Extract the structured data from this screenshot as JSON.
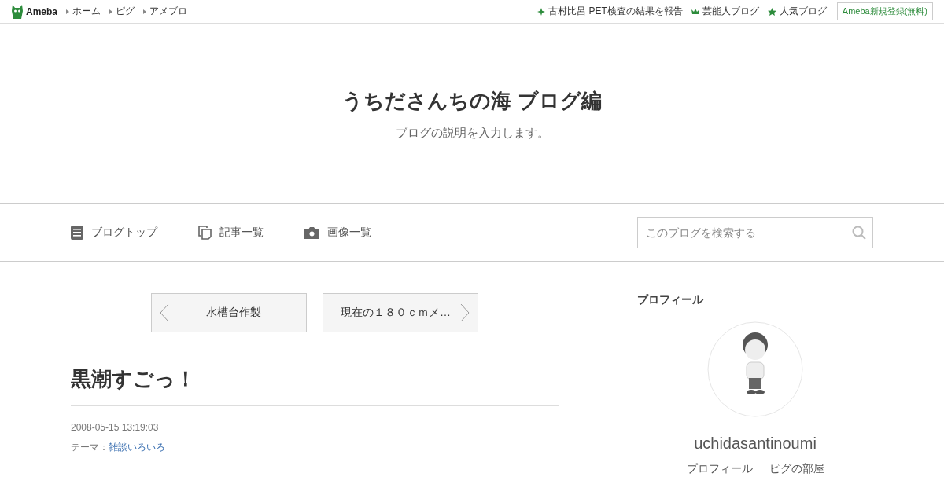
{
  "topbar": {
    "logo": "Ameba",
    "links": [
      "ホーム",
      "ピグ",
      "アメブロ"
    ],
    "right_links": [
      {
        "kind": "sparkle",
        "label": "古村比呂 PET検査の結果を報告"
      },
      {
        "kind": "crown",
        "label": "芸能人ブログ"
      },
      {
        "kind": "star",
        "label": "人気ブログ"
      }
    ],
    "signup": "Ameba新規登録(無料)"
  },
  "blog": {
    "title": "うちださんちの海 ブログ編",
    "description": "ブログの説明を入力します。"
  },
  "nav": {
    "items": [
      {
        "kind": "document",
        "label": "ブログトップ"
      },
      {
        "kind": "copy",
        "label": "記事一覧"
      },
      {
        "kind": "camera",
        "label": "画像一覧"
      }
    ],
    "search": {
      "placeholder": "このブログを検索する"
    }
  },
  "pager": {
    "prev": "水槽台作製",
    "next": "現在の１８０ｃｍメ…"
  },
  "article": {
    "title": "黒潮すごっ！",
    "date": "2008-05-15 13:19:03",
    "theme_label": "テーマ：",
    "theme": "雑談いろいろ"
  },
  "profile": {
    "heading": "プロフィール",
    "name": "uchidasantinoumi",
    "links": [
      "プロフィール",
      "ピグの部屋"
    ]
  }
}
